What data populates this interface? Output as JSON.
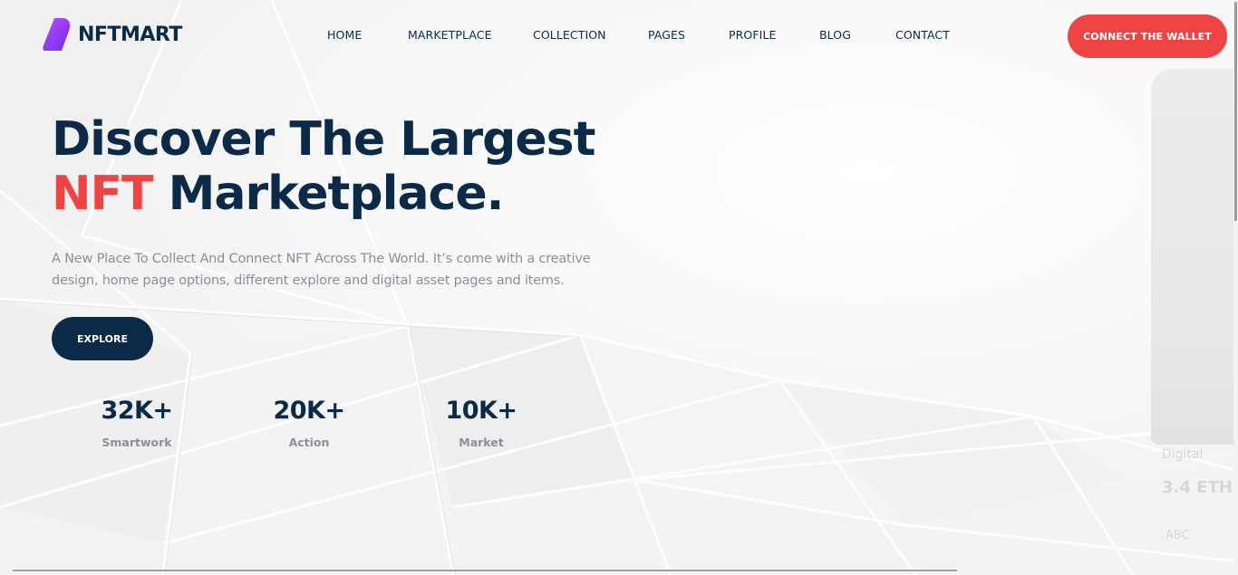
{
  "brand": {
    "name": "NFTMART"
  },
  "nav": {
    "items": [
      {
        "label": "HOME"
      },
      {
        "label": "MARKETPLACE"
      },
      {
        "label": "COLLECTION"
      },
      {
        "label": "PAGES"
      },
      {
        "label": "PROFILE"
      },
      {
        "label": "BLOG"
      },
      {
        "label": "CONTACT"
      }
    ]
  },
  "header": {
    "connect_label": "CONNECT THE WALLET"
  },
  "hero": {
    "title_line1": "Discover The Largest",
    "title_accent": "NFT",
    "title_rest": " Marketplace.",
    "description": "A New Place To Collect And Connect NFT Across The World. It’s come with a creative design, home page options, different explore and digital asset pages and items.",
    "explore_label": "EXPLORE"
  },
  "stats": [
    {
      "value": "32K+",
      "label": "Smartwork"
    },
    {
      "value": "20K+",
      "label": "Action"
    },
    {
      "value": "10K+",
      "label": "Market"
    }
  ],
  "card_preview": {
    "category": "Digital",
    "price": "3.4 ETH",
    "code": "ABC"
  },
  "colors": {
    "primary": "#0b2a47",
    "accent": "#ef4444",
    "muted": "#8a8f98",
    "background": "#f6f6f7"
  },
  "icons": {
    "logo": "nftmart-logo-icon"
  }
}
